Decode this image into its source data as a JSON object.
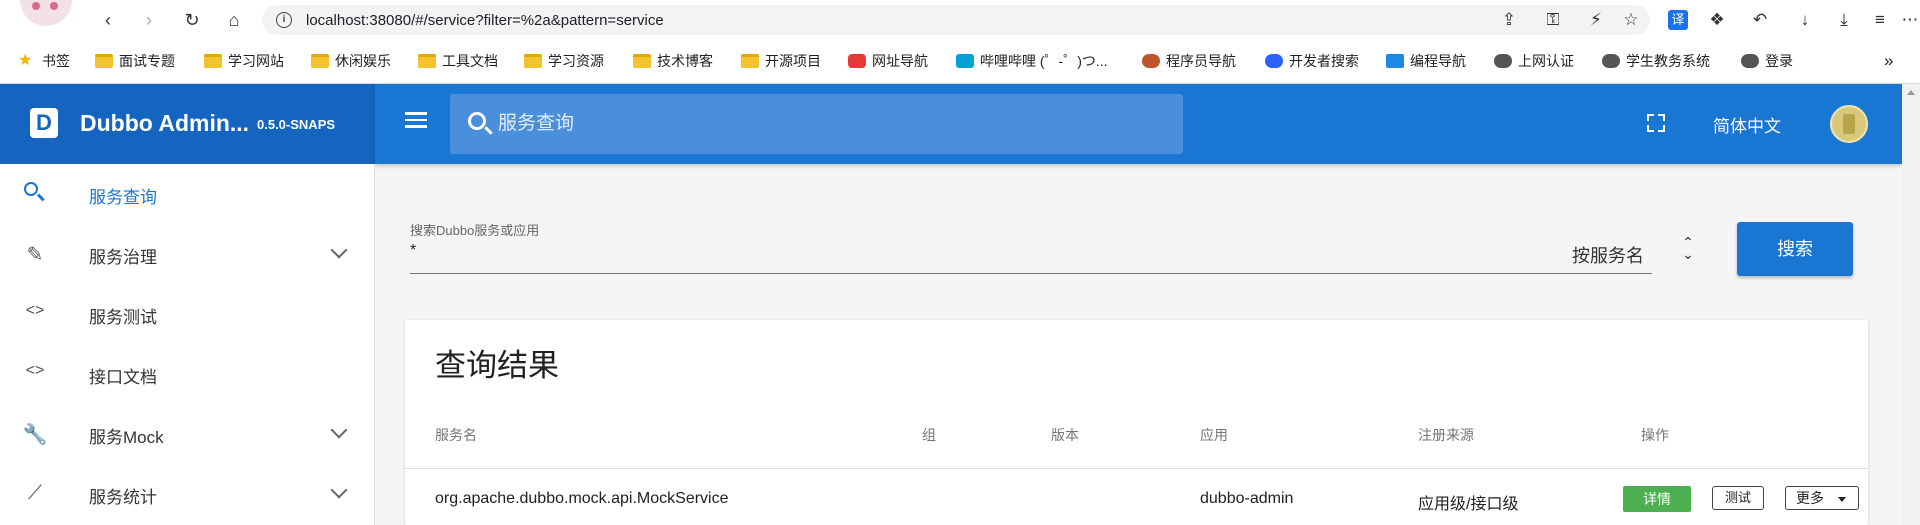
{
  "browser": {
    "url": "localhost:38080/#/service?filter=%2a&pattern=service",
    "bookmarks": [
      {
        "label": "书签",
        "icon": "star-icon"
      },
      {
        "label": "面试专题",
        "icon": "folder-icon"
      },
      {
        "label": "学习网站",
        "icon": "folder-icon"
      },
      {
        "label": "休闲娱乐",
        "icon": "folder-icon"
      },
      {
        "label": "工具文档",
        "icon": "folder-icon"
      },
      {
        "label": "学习资源",
        "icon": "folder-icon"
      },
      {
        "label": "技术博客",
        "icon": "folder-icon"
      },
      {
        "label": "开源项目",
        "icon": "folder-icon"
      },
      {
        "label": "网址导航",
        "icon": "site-icon"
      },
      {
        "label": "哔哩哔哩 (゜-゜)つ...",
        "icon": "bilibili-icon"
      },
      {
        "label": "程序员导航",
        "icon": "site-icon"
      },
      {
        "label": "开发者搜索",
        "icon": "search-site-icon"
      },
      {
        "label": "编程导航",
        "icon": "code-icon"
      },
      {
        "label": "上网认证",
        "icon": "globe-icon"
      },
      {
        "label": "学生教务系统",
        "icon": "globe-icon"
      },
      {
        "label": "登录",
        "icon": "globe-icon"
      }
    ],
    "overflow": "»"
  },
  "header": {
    "brand": "Dubbo Admin...",
    "version": "0.5.0-SNAPS",
    "search_placeholder": "服务查询",
    "language": "简体中文"
  },
  "sidebar": {
    "items": [
      {
        "label": "服务查询",
        "icon": "search-icon",
        "active": true
      },
      {
        "label": "服务治理",
        "icon": "pencil-icon",
        "expand": true
      },
      {
        "label": "服务测试",
        "icon": "code-icon"
      },
      {
        "label": "接口文档",
        "icon": "code-icon"
      },
      {
        "label": "服务Mock",
        "icon": "wrench-icon",
        "expand": true
      },
      {
        "label": "服务统计",
        "icon": "chart-icon",
        "expand": true
      }
    ]
  },
  "search": {
    "label": "搜索Dubbo服务或应用",
    "value": "*",
    "pattern": "按服务名",
    "button": "搜索"
  },
  "results": {
    "title": "查询结果",
    "columns": [
      "服务名",
      "组",
      "版本",
      "应用",
      "注册来源",
      "操作"
    ],
    "rows": [
      {
        "service": "org.apache.dubbo.mock.api.MockService",
        "group": "",
        "version": "",
        "application": "dubbo-admin",
        "source": "应用级/接口级",
        "actions": {
          "detail": "详情",
          "test": "测试",
          "more": "更多"
        }
      }
    ]
  },
  "colors": {
    "header_primary": "#1976d2",
    "header_dark": "#1565c0",
    "detail_tag": "#4caf50"
  }
}
